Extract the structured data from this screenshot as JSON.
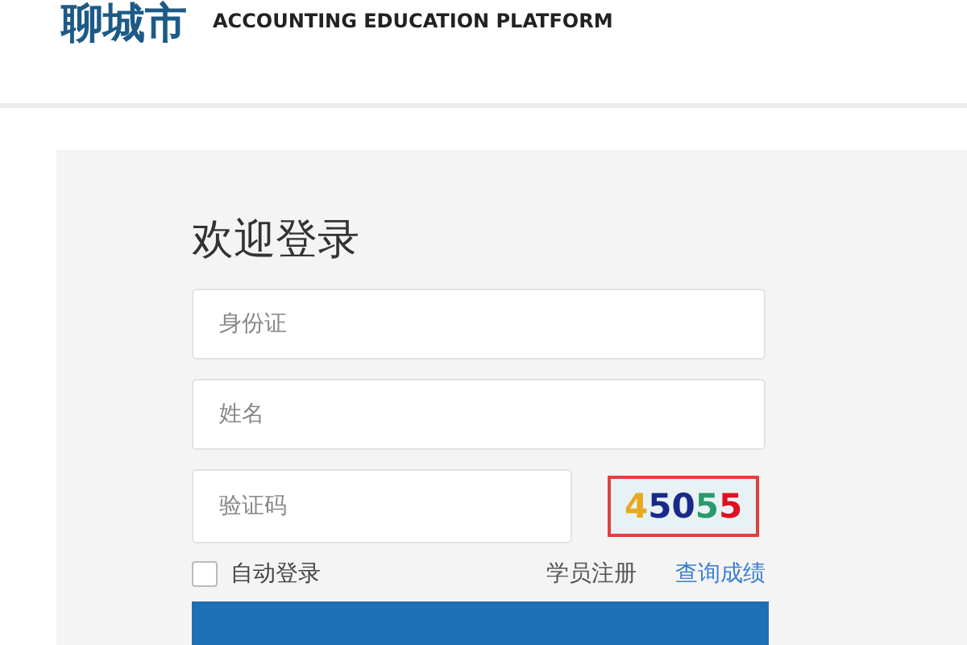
{
  "header": {
    "logo_text": "聊城市",
    "subtitle": "ACCOUNTING EDUCATION PLATFORM"
  },
  "login": {
    "title": "欢迎登录",
    "fields": [
      {
        "kind": "text",
        "placeholder": "身份证"
      },
      {
        "kind": "text",
        "placeholder": "姓名"
      },
      {
        "kind": "captcha",
        "placeholder": "验证码"
      }
    ],
    "captcha": [
      {
        "text": "4",
        "color": "#e8a820"
      },
      {
        "text": "5",
        "color": "#1a2a8a"
      },
      {
        "text": "0",
        "color": "#1a2a8a"
      },
      {
        "text": "5",
        "color": "#2a9a6a"
      },
      {
        "text": "5",
        "color": "#e01020"
      }
    ],
    "remember": {
      "label": "自动登录",
      "checked": false
    },
    "links": [
      {
        "label": "学员注册",
        "kind": "plain"
      },
      {
        "label": "查询成绩",
        "kind": "link"
      }
    ]
  }
}
